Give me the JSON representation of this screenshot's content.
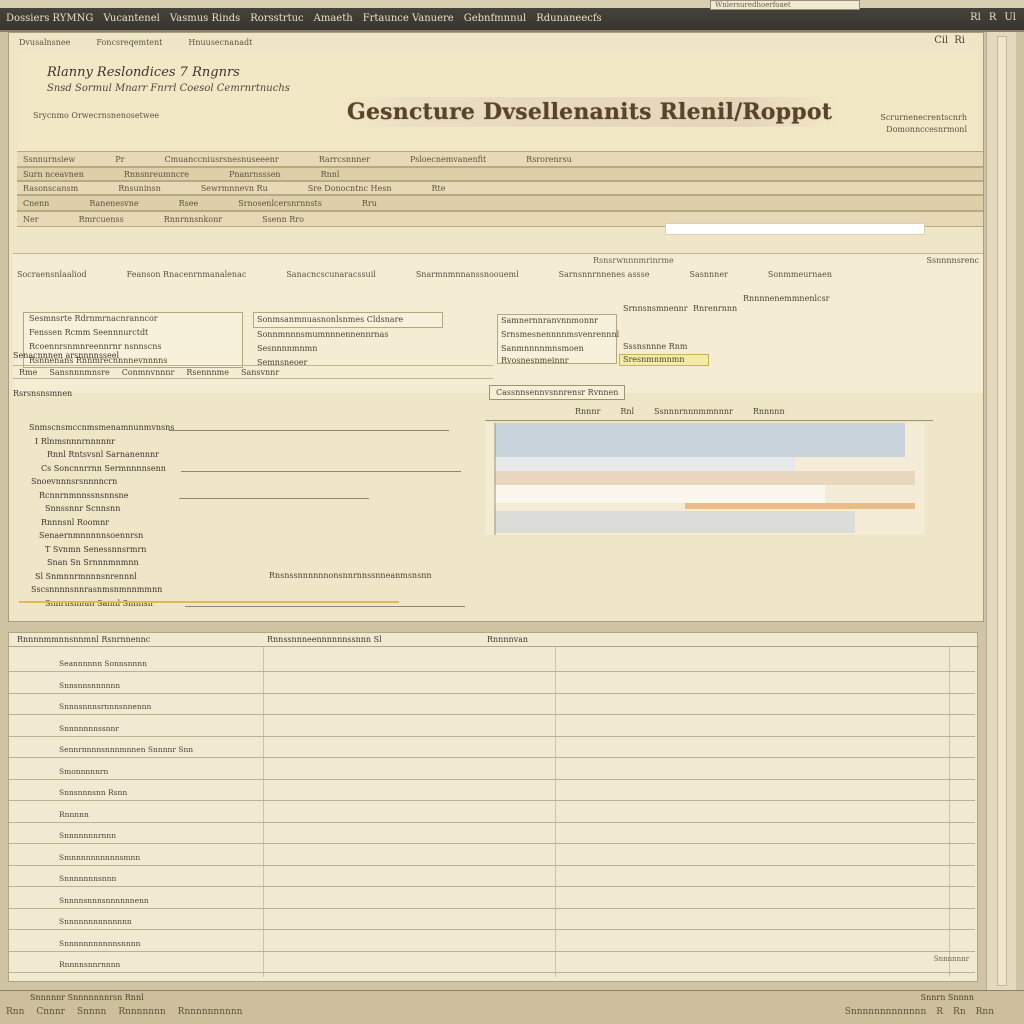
{
  "menubar": {
    "items": [
      "Dossiers RYMNG",
      "Vucantenel",
      "Vasmus Rinds",
      "Rorsstrtuc",
      "Amaeth",
      "Frtaunce Vanuere",
      "Gebnfmnnul",
      "Rdunaneecfs"
    ],
    "right_items": [
      "Rl",
      "R",
      "Ul"
    ],
    "address_pill": "Wnlersuredhoerfoaet"
  },
  "window": {
    "toolbar_items": [
      "Dvusalnsnee",
      "Foncsreqemtent",
      "Hnuusecnanadt"
    ],
    "controls": [
      "Cil",
      "Ri"
    ]
  },
  "header": {
    "org_name": "Rlanny Reslondices 7 Rngnrs",
    "org_subtitle": "Snsd Sormul Mnarr Fnrrl Coesol Cemrnrtnuchs",
    "org_small": "Srycnmo Orwecrnsnenosetwee",
    "report_title": "Gesncture Dvsellenanits Rlenil/Roppot",
    "right_line1": "Scrurnenecrentscnrh",
    "right_line2": "Domonnccesnrmonl"
  },
  "bands": [
    {
      "items": [
        "Ssnnurnsiew",
        "Pr",
        "Cmuanccniusrsnesnuseeenr",
        "Rarrcsnnner",
        "Psloecnemvanenfit",
        "Rsrorenrsu"
      ]
    },
    {
      "items": [
        "Surn nceavnen",
        "Rnnsnreumncre",
        "Pnanrnsssen",
        "Rnnl"
      ]
    },
    {
      "items": [
        "Rasonscansm",
        "Rnsuninsn",
        "Sewrmnnevn Ru",
        "Sre Donocntnc Hesn",
        "Rte"
      ]
    },
    {
      "items": [
        "Cnenn",
        "Ranenesvne",
        "Rsee",
        "Srnosenlcersnrnnsts",
        "Rru"
      ]
    },
    {
      "items": [
        "Ner",
        "Rmrcuenss",
        "Rnnrnnsnkonr",
        "Ssenn Rro"
      ]
    }
  ],
  "panel": {
    "head_items": [
      "Socraensnlaaliod",
      "Feanson Rnacenrnmanalenac",
      "Sanacncscunaracssuil",
      "Snarmnmnnanssnooueml",
      "Sarnsnnrnnenes assse",
      "Sasnnner",
      "Sonmmeurnaen"
    ],
    "sub_label": "Rsnsrwnnnmrinrme",
    "right_tab": "Ssnnnnsrenc",
    "form_rows": [
      "Sesmnsrte Rdrnmrnacnranncor",
      "Fenssen Rcmm Seennnurctdt",
      "Rcoennrsnmnreennrnr nsnnscns",
      "Rsnnenans Rnnmrecnnnnevnnnns"
    ],
    "mid_rows": [
      "Sonmsanmnuasnonlsnmes Cldsnare",
      "Sonnmnnnsmumnnnennennrnas",
      "Sesnnnnmnmn",
      "Semnsneoer"
    ],
    "right_rows": [
      "Samnernnranvnnmonnr",
      "Srnsmesnennnnmsvenrennnl",
      "Sanmnnnnmnsmoen",
      "Rvosnesnmeinnr"
    ],
    "right_cols": [
      "Srnnsnsmnennr",
      "Rnrenrnnn",
      "Rnnnnenemmnenlcsr"
    ],
    "right_sub": [
      "Sssnsnnne Rnm",
      "Sresnmnmnmn"
    ]
  },
  "section": {
    "label": "Senacnnnen arsnnnnsseel",
    "cols": [
      "Rme",
      "Sansnnnmnsre",
      "Conmnvnnnr",
      "Rsennnme",
      "Sansvnnr"
    ],
    "sub_label": "Rsrsnsnsmnen"
  },
  "tree": {
    "nodes": [
      {
        "label": "Snmscnsmccnmsmenamnunmvnsns",
        "indent": 0,
        "line": 420
      },
      {
        "label": "I Rlnmsnnnrnnnnnr",
        "indent": 6,
        "line": 0
      },
      {
        "label": "Rnnl Rntsvsnl Sarnanennnr",
        "indent": 18,
        "line": 0
      },
      {
        "label": "Cs Soncnnrrnn Sermnnnnsenn",
        "indent": 12,
        "line": 280
      },
      {
        "label": "Snoevnnnsrsnnnncrn",
        "indent": 2,
        "line": 0
      },
      {
        "label": "Rcnnrnmnnssnsnnsne",
        "indent": 10,
        "line": 190
      },
      {
        "label": "Snnssnnr Scnnsnn",
        "indent": 16,
        "line": 0
      },
      {
        "label": "Rnnnsnl Roomnr",
        "indent": 12,
        "line": 0
      },
      {
        "label": "Senaernmnnnnnsoennrsn",
        "indent": 10,
        "line": 0
      },
      {
        "label": "T Svnmn Senessnnsrmrn",
        "indent": 16,
        "line": 0
      },
      {
        "label": "Snan Sn Srnnnmnmnn",
        "indent": 18,
        "line": 0
      },
      {
        "label": "Sl  Snmnnrmnnnsnrennnl",
        "indent": 6,
        "line": 0
      },
      {
        "label": "Sscsnnnnsnnrasnmsnmnnmmnn",
        "indent": 2,
        "line": 0
      },
      {
        "label": "Snnrnsnnun Sannl Snnnsn",
        "indent": 16,
        "line": 380
      }
    ],
    "footnote": "Rnsnssnnnnnnonsnnrnnssnneanmsnsnn"
  },
  "chart": {
    "title": "Cassnnsennvsnnrensr Rvnnen",
    "cols": [
      "Rnnnr",
      "Rnl",
      "Ssnnnrnnnmmnnnr",
      "Rnnnnn"
    ]
  },
  "grid": {
    "head": [
      "Rnnnnmmnnsnnmnl Rsnrnnennc",
      "Rnnssnnneennnnnnssnnn Sl",
      "Rnnnnvan"
    ],
    "row_labels": [
      "Seannnnnn Sonnsnnnn",
      "Snnsnnsnnnnnn",
      "Snnnsnnnsrnnnsnnennn",
      "Snnnnnnnssnnr",
      "Sennrnnnnsnnnmnnen Snnnnr Snn",
      "Smonnnnnrn",
      "Snnsnnnsnn Rsnn",
      "Rnnnnn",
      "Snnnnnnnrnnn",
      "Smnnnnnnnnnnsmnn",
      "Snnnnnnnsnnn",
      "Snnnnsnnnsnnnnnnenn",
      "Snnnnnnnnnnnnnn",
      "Snnnnnnnnnnnsnnnn",
      "Rnnnnsnnrnnnn"
    ],
    "right_note": "Snnnnnnr"
  },
  "footer": {
    "left": "Snnnnnr Snnnnnnnrsn Rnnl",
    "right": "Snnrn Snnnn",
    "nav_left": [
      "Rnn",
      "Cnnnr",
      "Snnnn",
      "Rnnnnnnn",
      "Rnnnnnnnnnn"
    ],
    "nav_right": [
      "Snnnnnnnnnnnnn",
      "R",
      "Rn",
      "Rnn"
    ]
  }
}
